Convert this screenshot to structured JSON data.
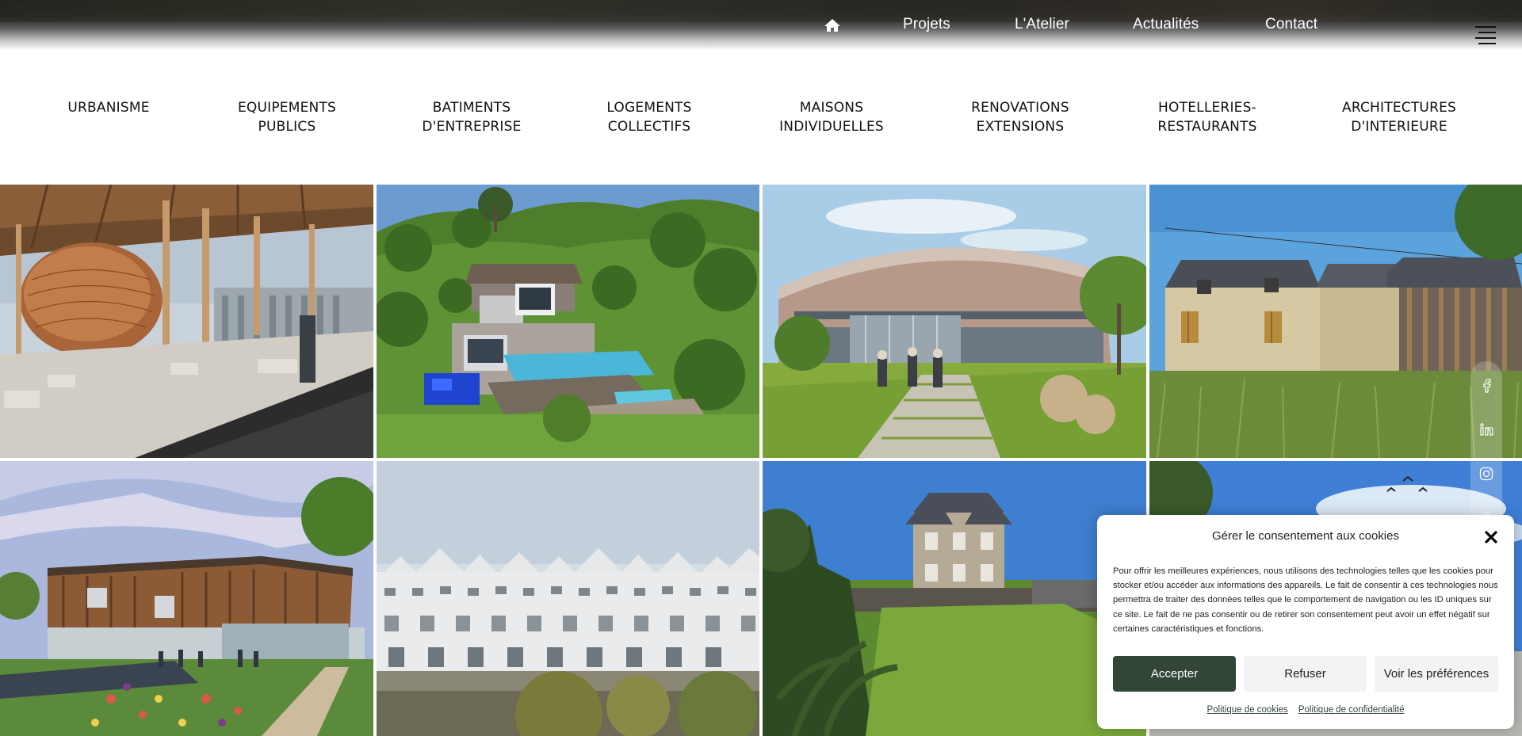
{
  "nav": {
    "home_icon": "home-icon",
    "items": [
      {
        "label": "Projets"
      },
      {
        "label": "L'Atelier"
      },
      {
        "label": "Actualités"
      },
      {
        "label": "Contact"
      }
    ],
    "menu_icon": "hamburger-menu-icon"
  },
  "categories": [
    {
      "line1": "URBANISME",
      "line2": ""
    },
    {
      "line1": "EQUIPEMENTS",
      "line2": "PUBLICS"
    },
    {
      "line1": "BATIMENTS",
      "line2": "D'ENTREPRISE"
    },
    {
      "line1": "LOGEMENTS",
      "line2": "COLLECTIFS"
    },
    {
      "line1": "MAISONS",
      "line2": "INDIVIDUELLES"
    },
    {
      "line1": "RENOVATIONS",
      "line2": "EXTENSIONS"
    },
    {
      "line1": "HOTELLERIES-",
      "line2": "RESTAURANTS"
    },
    {
      "line1": "ARCHITECTURES",
      "line2": "D'INTERIEURE"
    }
  ],
  "projects": [
    {
      "subject": "timber canopy with woven pod structure"
    },
    {
      "subject": "hillside villa with pools"
    },
    {
      "subject": "curved office building with lawn"
    },
    {
      "subject": "stone barn renovation with meadow"
    },
    {
      "subject": "timber-clad public building with gardens"
    },
    {
      "subject": "waterfront housing row"
    },
    {
      "subject": "stone manor hotel with lawn"
    },
    {
      "subject": "coastal scene with birds"
    }
  ],
  "social": {
    "icons": [
      "facebook-icon",
      "linkedin-icon",
      "instagram-icon",
      "google-icon"
    ]
  },
  "cookie": {
    "title": "Gérer le consentement aux cookies",
    "text": "Pour offrir les meilleures expériences, nous utilisons des technologies telles que les cookies pour stocker et/ou accéder aux informations des appareils. Le fait de consentir à ces technologies nous permettra de traiter des données telles que le comportement de navigation ou les ID uniques sur ce site. Le fait de ne pas consentir ou de retirer son consentement peut avoir un effet négatif sur certaines caractéristiques et fonctions.",
    "accept": "Accepter",
    "refuse": "Refuser",
    "preferences": "Voir les préférences",
    "cookie_policy": "Politique de cookies",
    "privacy_policy": "Politique de confidentialité",
    "accent_color": "#324537"
  }
}
